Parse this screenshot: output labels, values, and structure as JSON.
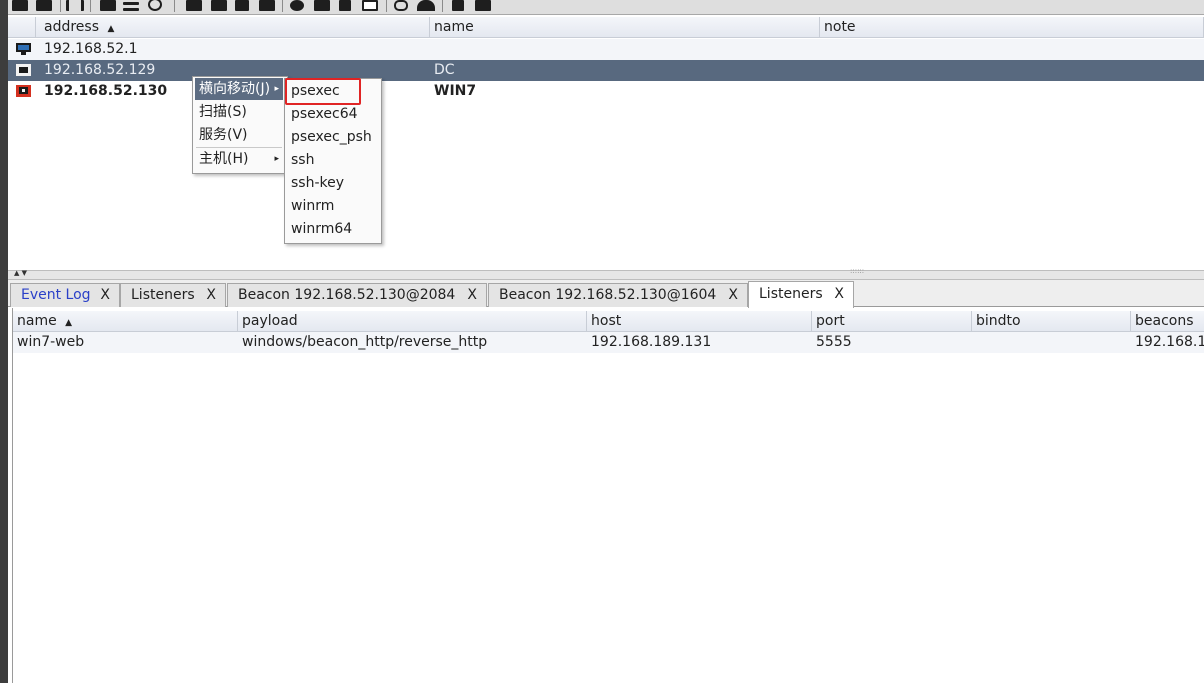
{
  "toolbar": {
    "icons": [
      "new-connection-icon",
      "disconnect-icon",
      "headphones-icon",
      "pivot-graph-icon",
      "session-table-icon",
      "targets-icon",
      "screenshot-icon",
      "download-icon",
      "key-icon",
      "image-icon",
      "settings-icon",
      "coffee-icon",
      "note-icon",
      "console-icon",
      "link-icon",
      "cloud-icon",
      "book-icon",
      "package-icon"
    ]
  },
  "targets_table": {
    "columns": [
      {
        "label": "address",
        "sort": "▲"
      },
      {
        "label": "name"
      },
      {
        "label": "note"
      }
    ],
    "rows": [
      {
        "address": "192.168.52.1",
        "name": "",
        "note": "",
        "state": "normal"
      },
      {
        "address": "192.168.52.129",
        "name": "DC",
        "note": "",
        "state": "selected"
      },
      {
        "address": "192.168.52.130",
        "name": "WIN7",
        "note": "",
        "state": "compromised"
      }
    ]
  },
  "context_menu": {
    "items": [
      {
        "label": "横向移动(J)",
        "mnemonic": "J",
        "has_submenu": true,
        "active": true
      },
      {
        "label": "扫描(S)",
        "mnemonic": "S"
      },
      {
        "label": "服务(V)",
        "mnemonic": "V"
      },
      {
        "label": "主机(H)",
        "mnemonic": "H",
        "has_submenu": true
      }
    ],
    "submenu_arrow": "▸"
  },
  "lateral_submenu": {
    "items": [
      "psexec",
      "psexec64",
      "psexec_psh",
      "ssh",
      "ssh-key",
      "winrm",
      "winrm64"
    ],
    "highlighted": "psexec",
    "highlight_color": "#e02424"
  },
  "splitter": {
    "arrows": "▲ ▼",
    "grip": "::::::"
  },
  "tabs": [
    {
      "label": "Event Log",
      "close": "X"
    },
    {
      "label": "Listeners",
      "close": "X"
    },
    {
      "label": "Beacon 192.168.52.130@2084",
      "close": "X"
    },
    {
      "label": "Beacon 192.168.52.130@1604",
      "close": "X"
    },
    {
      "label": "Listeners",
      "close": "X",
      "active": true
    }
  ],
  "listeners_table": {
    "columns": [
      {
        "label": "name",
        "sort": "▲"
      },
      {
        "label": "payload"
      },
      {
        "label": "host"
      },
      {
        "label": "port"
      },
      {
        "label": "bindto"
      },
      {
        "label": "beacons"
      }
    ],
    "rows": [
      {
        "name": "win7-web",
        "payload": "windows/beacon_http/reverse_http",
        "host": "192.168.189.131",
        "port": "5555",
        "bindto": "",
        "beacons": "192.168.1"
      }
    ]
  },
  "colors": {
    "selection": "#58697f",
    "menu_active": "#5c6c82",
    "event_log_tab_text": "#2a40c8",
    "compromised_icon": "#d4301f"
  }
}
